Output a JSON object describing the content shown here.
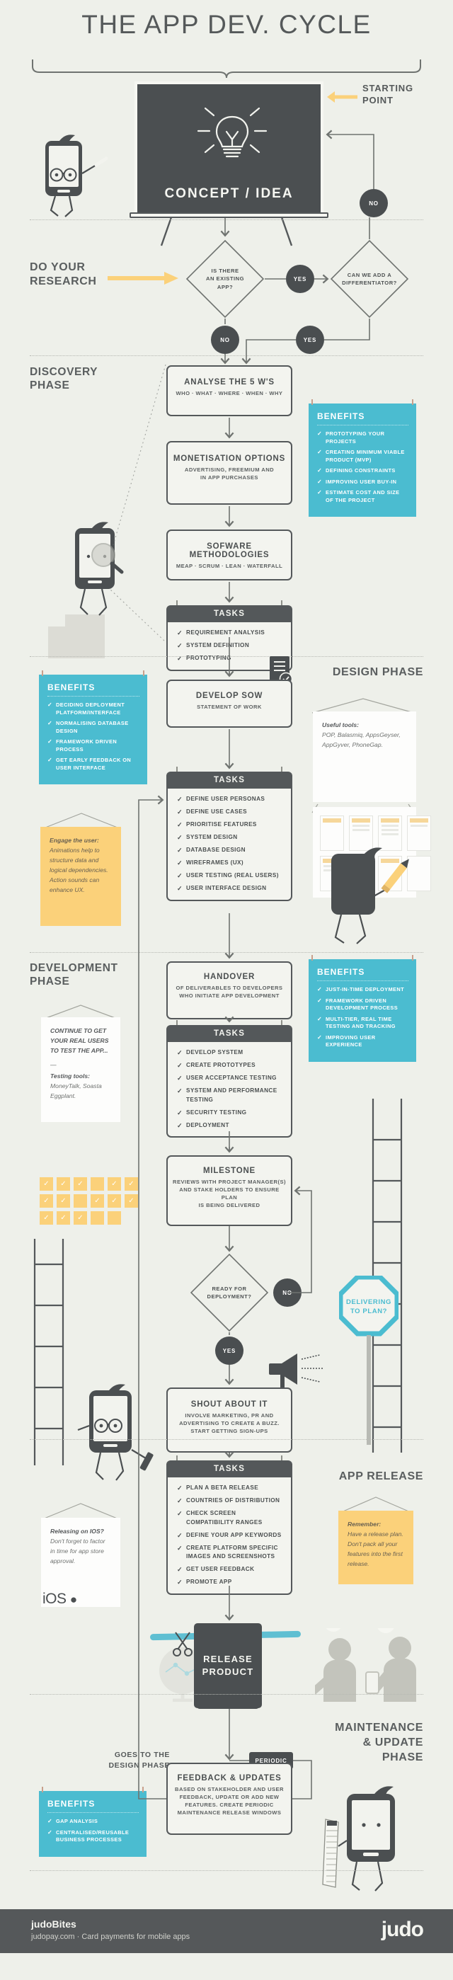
{
  "title": "THE APP DEV. CYCLE",
  "starting_point": {
    "label": "STARTING\nPOINT",
    "arrow_color": "#fbd17a"
  },
  "board": {
    "caption": "CONCEPT / IDEA",
    "icon": "lightbulb-icon"
  },
  "research": {
    "label": "DO YOUR\nRESEARCH",
    "decision_1": "IS THERE AN EXISTING APP?",
    "decision_1_lines": [
      "IS THERE",
      "AN EXISTING",
      "APP?"
    ],
    "decision_2": "CAN WE ADD A DIFFERENTIATOR?",
    "decision_2_lines": [
      "CAN WE ADD A",
      "DIFFERENTIATOR?"
    ],
    "yes": "YES",
    "no": "NO"
  },
  "discovery": {
    "label": "DISCOVERY\nPHASE",
    "boxes": [
      {
        "title": "ANALYSE THE 5 W'S",
        "sub": "WHO · WHAT · WHERE · WHEN · WHY"
      },
      {
        "title": "MONETISATION OPTIONS",
        "sub": "ADVERTISING, FREEMIUM AND\nIN APP PURCHASES"
      },
      {
        "title": "SOFWARE METHODOLOGIES",
        "sub": "MEAP · SCRUM · LEAN · WATERFALL"
      }
    ],
    "tasks": {
      "heading": "TASKS",
      "items": [
        "REQUIREMENT ANALYSIS",
        "SYSTEM DEFINITION",
        "PROTOTYPING"
      ]
    },
    "benefits": {
      "heading": "BENEFITS",
      "items": [
        "PROTOTYPING YOUR PROJECTS",
        "CREATING MINIMUM VIABLE PRODUCT (MVP)",
        "DEFINING CONSTRAINTS",
        "IMPROVING USER BUY-IN",
        "ESTIMATE COST AND SIZE OF THE PROJECT"
      ]
    }
  },
  "design": {
    "label": "DESIGN PHASE",
    "box": {
      "title": "DEVELOP SOW",
      "sub": "STATEMENT OF WORK"
    },
    "tasks": {
      "heading": "TASKS",
      "items": [
        "DEFINE USER PERSONAS",
        "DEFINE USE CASES",
        "PRIORITISE FEATURES",
        "SYSTEM DESIGN",
        "DATABASE DESIGN",
        "WIREFRAMES (UX)",
        "USER TESTING (REAL USERS)",
        "USER INTERFACE DESIGN"
      ]
    },
    "benefits": {
      "heading": "BENEFITS",
      "items": [
        "DECIDING DEPLOYMENT PLATFORM/INTERFACE",
        "NORMALISING DATABASE DESIGN",
        "FRAMEWORK DRIVEN PROCESS",
        "GET EARLY FEEDBACK ON USER INTERFACE"
      ]
    },
    "tools_note": {
      "head": "Useful tools:",
      "body": "POP, Balasmiq, AppsGeyser, AppGyver, PhoneGap."
    },
    "engage_note": {
      "head": "Engage the user:",
      "body": "Animations help to structure data and logical dependencies. Action sounds can enhance UX."
    }
  },
  "development": {
    "label": "DEVELOPMENT\nPHASE",
    "handover": {
      "title": "HANDOVER",
      "sub": "OF DELIVERABLES TO DEVELOPERS\nWHO INITIATE APP DEVELOPMENT"
    },
    "tasks": {
      "heading": "TASKS",
      "items": [
        "DEVELOP SYSTEM",
        "CREATE PROTOTYPES",
        "USER ACCEPTANCE TESTING",
        "SYSTEM AND PERFORMANCE TESTING",
        "SECURITY TESTING",
        "DEPLOYMENT"
      ]
    },
    "benefits": {
      "heading": "BENEFITS",
      "items": [
        "JUST-IN-TIME DEPLOYMENT",
        "FRAMEWORK DRIVEN DEVELOPMENT PROCESS",
        "MULTI-TIER, REAL TIME TESTING AND TRACKING",
        "IMPROVING USER EXPERIENCE"
      ]
    },
    "testing_note": {
      "head": "CONTINUE TO GET YOUR REAL USERS TO TEST THE APP...",
      "divider": "—",
      "sub_head": "Testing tools:",
      "body": "MoneyTalk, Soasta Eggplant."
    },
    "milestone": {
      "title": "MILESTONE",
      "sub": "REVIEWS WITH PROJECT MANAGER(S)\nAND STAKE HOLDERS TO ENSURE PLAN\nIS BEING DELIVERED"
    },
    "decision": {
      "lines": [
        "READY FOR",
        "DEPLOYMENT?"
      ],
      "yes": "YES",
      "no": "NO"
    },
    "stop_sign": {
      "lines": [
        "DELIVERING",
        "TO PLAN?"
      ],
      "color": "#4bbcd0"
    },
    "shout": {
      "title": "SHOUT ABOUT IT",
      "sub": "INVOLVE MARKETING, PR AND\nADVERTISING TO CREATE A BUZZ.\nSTART GETTING SIGN-UPS"
    }
  },
  "release": {
    "label": "APP RELEASE",
    "tasks": {
      "heading": "TASKS",
      "items": [
        "PLAN A BETA RELEASE",
        "COUNTRIES OF DISTRIBUTION",
        "CHECK SCREEN COMPATIBILITY RANGES",
        "DEFINE YOUR APP KEYWORDS",
        "CREATE PLATFORM SPECIFIC IMAGES AND SCREENSHOTS",
        "GET USER FEEDBACK",
        "PROMOTE APP"
      ]
    },
    "ios_note": {
      "head": "Releasing on IOS?",
      "body": "Don't forget to factor in time for app store approval.",
      "logo": "iOS"
    },
    "remember_note": {
      "head": "Remember:",
      "body": "Have a release plan. Don't pack all your features into the first release."
    },
    "release_box": "RELEASE PRODUCT",
    "release_box_lines": [
      "RELEASE",
      "PRODUCT"
    ]
  },
  "maintenance": {
    "label": "MAINTENANCE\n& UPDATE\nPHASE",
    "goes_to": "GOES TO THE\nDESIGN PHASE",
    "periodic": "PERIODIC",
    "feedback": {
      "title": "FEEDBACK & UPDATES",
      "sub": "BASED ON STAKEHOLDER AND USER\nFEEDBACK, UPDATE OR ADD NEW\nFEATURES. CREATE PERIODIC\nMAINTENANCE RELEASE WINDOWS"
    },
    "benefits": {
      "heading": "BENEFITS",
      "items": [
        "GAP ANALYSIS",
        "CENTRALISED/REUSABLE BUSINESS PROCESSES"
      ]
    }
  },
  "footer": {
    "title": "judoBites",
    "subtitle": "judopay.com · Card payments for mobile apps",
    "logo": "judo"
  },
  "colors": {
    "background": "#eef0ea",
    "ink": "#54585a",
    "accent_teal": "#4bbcd0",
    "accent_yellow": "#fbd17a",
    "paper": "#fdfdfc"
  }
}
